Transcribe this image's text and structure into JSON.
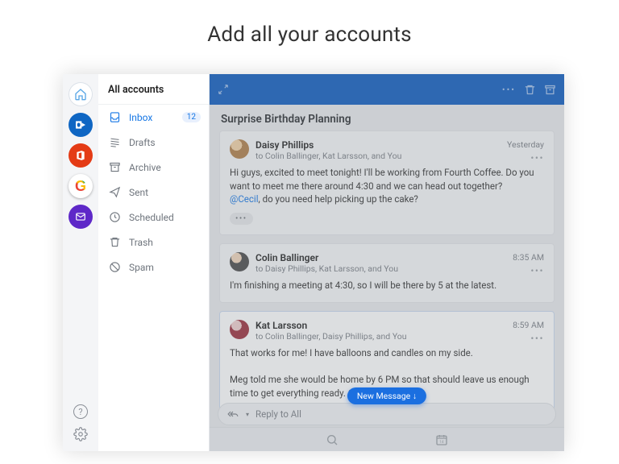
{
  "heading": "Add all your accounts",
  "colors": {
    "blue": "#0f5cbf",
    "accent": "#1677e5"
  },
  "accounts": [
    "home",
    "outlook",
    "office",
    "google",
    "yahoo"
  ],
  "footer_icons": [
    "help",
    "settings"
  ],
  "sidebar": {
    "title": "All accounts",
    "folders": [
      {
        "icon": "inbox",
        "label": "Inbox",
        "badge": "12",
        "selected": true
      },
      {
        "icon": "drafts",
        "label": "Drafts"
      },
      {
        "icon": "archive",
        "label": "Archive"
      },
      {
        "icon": "sent",
        "label": "Sent"
      },
      {
        "icon": "schedule",
        "label": "Scheduled"
      },
      {
        "icon": "trash",
        "label": "Trash"
      },
      {
        "icon": "spam",
        "label": "Spam"
      }
    ]
  },
  "conversation": {
    "subject": "Surprise Birthday Planning",
    "reply_placeholder": "Reply to All",
    "new_message_pill": "New Message  ↓",
    "messages": [
      {
        "from": "Daisy Phillips",
        "to": "to Colin Ballinger, Kat Larsson, and You",
        "time": "Yesterday",
        "body_1": "Hi guys, excited to meet tonight! I'll be working from Fourth Coffee. Do you want to meet me there around 4:30 and we can head out together?",
        "mention": "@Cecil",
        "body_2": ", do you need help picking up the cake?",
        "avatar": "daisy",
        "show_collapse": true
      },
      {
        "from": "Colin Ballinger",
        "to": "to Daisy Phillips, Kat Larsson, and You",
        "time": "8:35 AM",
        "body_1": "I'm finishing a meeting at 4:30, so I will be there by 5 at the latest.",
        "avatar": "colin"
      },
      {
        "from": "Kat Larsson",
        "to": "to Colin Ballinger, Daisy Phillips, and You",
        "time": "8:59 AM",
        "body_1": "That works for me! I have balloons and candles on my side.",
        "body_3": "Meg told me she would be home by 6 PM so that should leave us enough time to get everything ready. Can't wait!",
        "avatar": "kat",
        "highlight": true
      }
    ]
  }
}
